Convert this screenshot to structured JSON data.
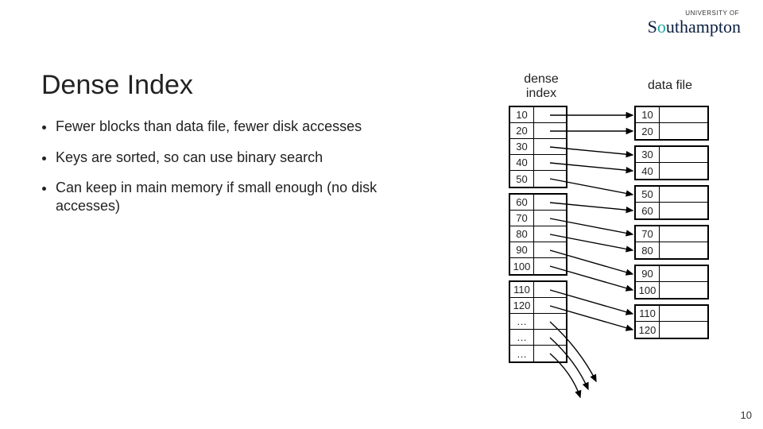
{
  "logo": {
    "top": "UNIVERSITY OF",
    "main_pre": "S",
    "main_accent": "o",
    "main_post": "uthampton"
  },
  "title": "Dense Index",
  "bullets": [
    "Fewer blocks than data file, fewer disk accesses",
    "Keys are sorted, so can use binary search",
    "Can keep in main memory if small enough (no disk accesses)"
  ],
  "labels": {
    "dense_index": "dense index",
    "data_file": "data file"
  },
  "index_blocks": [
    [
      "10",
      "20",
      "30",
      "40",
      "50"
    ],
    [
      "60",
      "70",
      "80",
      "90",
      "100"
    ],
    [
      "110",
      "120",
      "…",
      "…",
      "…"
    ]
  ],
  "data_blocks": [
    [
      "10",
      "20"
    ],
    [
      "30",
      "40"
    ],
    [
      "50",
      "60"
    ],
    [
      "70",
      "80"
    ],
    [
      "90",
      "100"
    ],
    [
      "110",
      "120"
    ]
  ],
  "page_number": "10"
}
